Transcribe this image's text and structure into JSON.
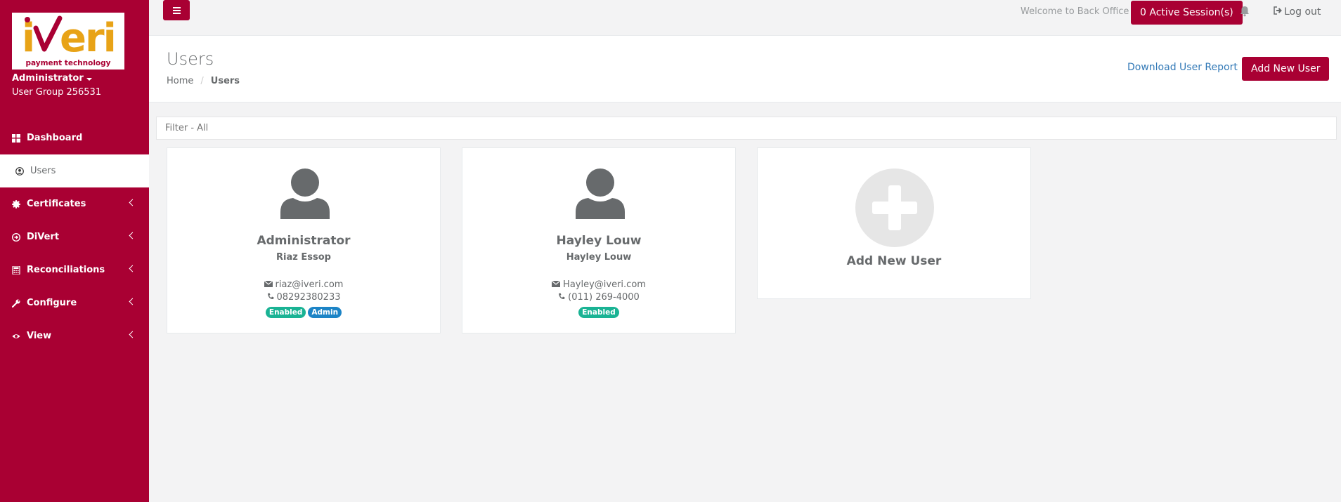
{
  "brand": {
    "logo_text": "iveri",
    "tagline": "payment technology",
    "colors": {
      "primary": "#a90033",
      "logo_orange": "#e8a317"
    }
  },
  "profile": {
    "name": "Administrator",
    "group": "User Group 256531"
  },
  "sidebar": {
    "items": [
      {
        "label": "Dashboard",
        "icon": "dashboard-icon"
      },
      {
        "label": "Users",
        "icon": "user-circle-icon",
        "active": true
      },
      {
        "label": "Certificates",
        "icon": "certificate-icon"
      },
      {
        "label": "DiVert",
        "icon": "divert-icon"
      },
      {
        "label": "Reconciliations",
        "icon": "calculator-icon"
      },
      {
        "label": "Configure",
        "icon": "wrench-icon"
      },
      {
        "label": "View",
        "icon": "eye-icon"
      }
    ]
  },
  "topbar": {
    "welcome": "Welcome to Back Office",
    "sessions": "0 Active Session(s)",
    "logout": "Log out"
  },
  "page": {
    "title": "Users",
    "breadcrumb": {
      "home": "Home",
      "current": "Users"
    },
    "report_link": "Download User Report",
    "add_button": "Add New User"
  },
  "filter": {
    "placeholder": "Filter - All"
  },
  "users": [
    {
      "name": "Administrator",
      "fullname": "Riaz Essop",
      "email": "riaz@iveri.com",
      "phone": "08292380233",
      "badges": [
        "Enabled",
        "Admin"
      ]
    },
    {
      "name": "Hayley Louw",
      "fullname": "Hayley Louw",
      "email": "Hayley@iveri.com",
      "phone": "(011) 269-4000",
      "badges": [
        "Enabled"
      ]
    }
  ],
  "add_card": {
    "label": "Add New User"
  }
}
